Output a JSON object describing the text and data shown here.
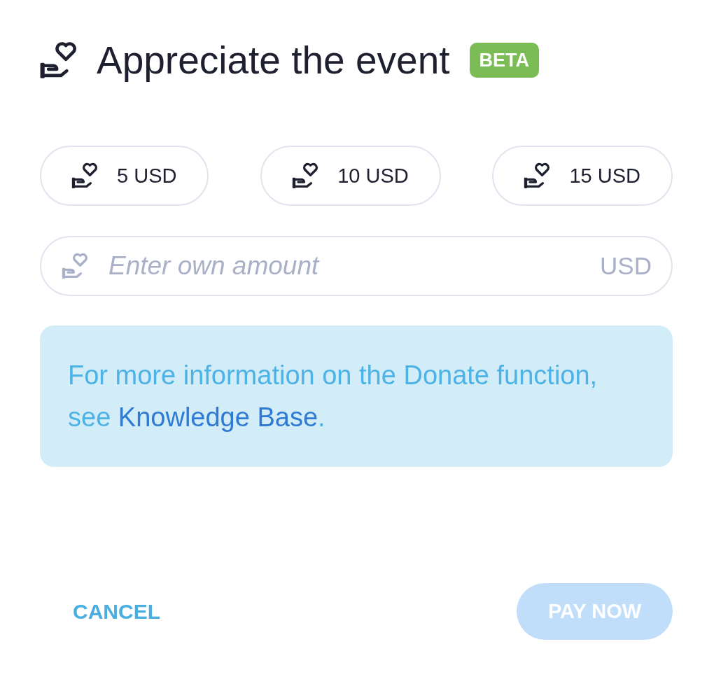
{
  "header": {
    "title": "Appreciate the event",
    "badge": "BETA"
  },
  "amounts": [
    {
      "label": "5 USD",
      "selected": false
    },
    {
      "label": "10 USD",
      "selected": false
    },
    {
      "label": "15 USD",
      "selected": false
    }
  ],
  "custom_amount": {
    "placeholder": "Enter own amount",
    "currency": "USD"
  },
  "info": {
    "text": "For more information on the Donate function, see ",
    "link": "Knowledge Base",
    "suffix": "."
  },
  "actions": {
    "cancel": "CANCEL",
    "pay": {
      "label": "PAY NOW",
      "disabled": true
    }
  }
}
